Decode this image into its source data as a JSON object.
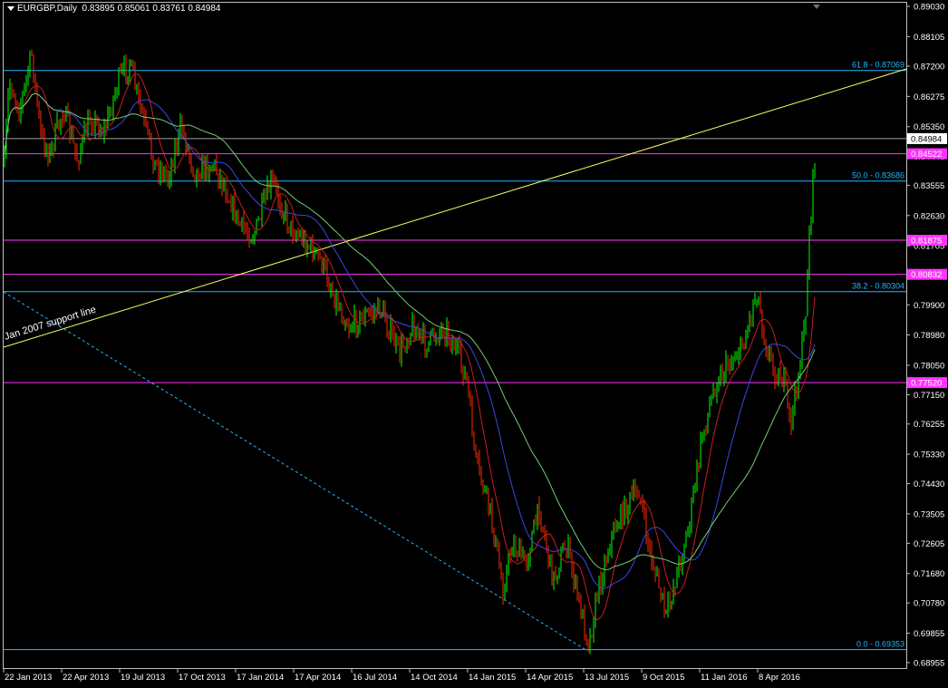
{
  "header": {
    "symbol": "EURGBP,Daily",
    "open": "0.83895",
    "high": "0.85061",
    "low": "0.83761",
    "close": "0.84984"
  },
  "chart": {
    "price_axis_labels": [
      "0.89030",
      "0.88105",
      "0.87200",
      "0.86275",
      "0.85350",
      "0.84445",
      "0.83555",
      "0.82630",
      "0.81705",
      "0.80805",
      "0.79900",
      "0.78980",
      "0.78050",
      "0.77150",
      "0.76255",
      "0.75330",
      "0.74430",
      "0.73505",
      "0.72605",
      "0.71680",
      "0.70780",
      "0.69855",
      "0.68955"
    ],
    "date_labels": [
      "22 Jan 2013",
      "22 Apr 2013",
      "19 Jul 2013",
      "17 Oct 2013",
      "17 Jan 2014",
      "17 Apr 2014",
      "16 Jul 2014",
      "14 Oct 2014",
      "14 Jan 2015",
      "14 Apr 2015",
      "13 Jul 2015",
      "9 Oct 2015",
      "11 Jan 2016",
      "8 Apr 2016"
    ],
    "fib_levels": [
      {
        "label": "61.8 - 0.87069",
        "price": 0.87069
      },
      {
        "label": "50.0 - 0.83686",
        "price": 0.83686
      },
      {
        "label": "38.2 - 0.80304",
        "price": 0.80304
      },
      {
        "label": "0.0 - 0.69353",
        "price": 0.69353
      }
    ],
    "magenta_levels": [
      {
        "label": "0.84522",
        "price": 0.84522
      },
      {
        "label": "0.81875",
        "price": 0.81875
      },
      {
        "label": "0.80832",
        "price": 0.80832
      },
      {
        "label": "0.77520",
        "price": 0.7752
      }
    ],
    "current_price": {
      "label": "0.84984",
      "price": 0.84984
    },
    "trendline_label": "Jan 2007 support line",
    "colors": {
      "bull": "#00ff00",
      "bear": "#ff2a00",
      "fib": "#22b8ff",
      "magenta": "#ff33ff",
      "trendline": "#ffff66",
      "ma_red": "#c81e1e",
      "ma_blue": "#3b48e0",
      "ma_green": "#6fcf6f"
    }
  }
}
